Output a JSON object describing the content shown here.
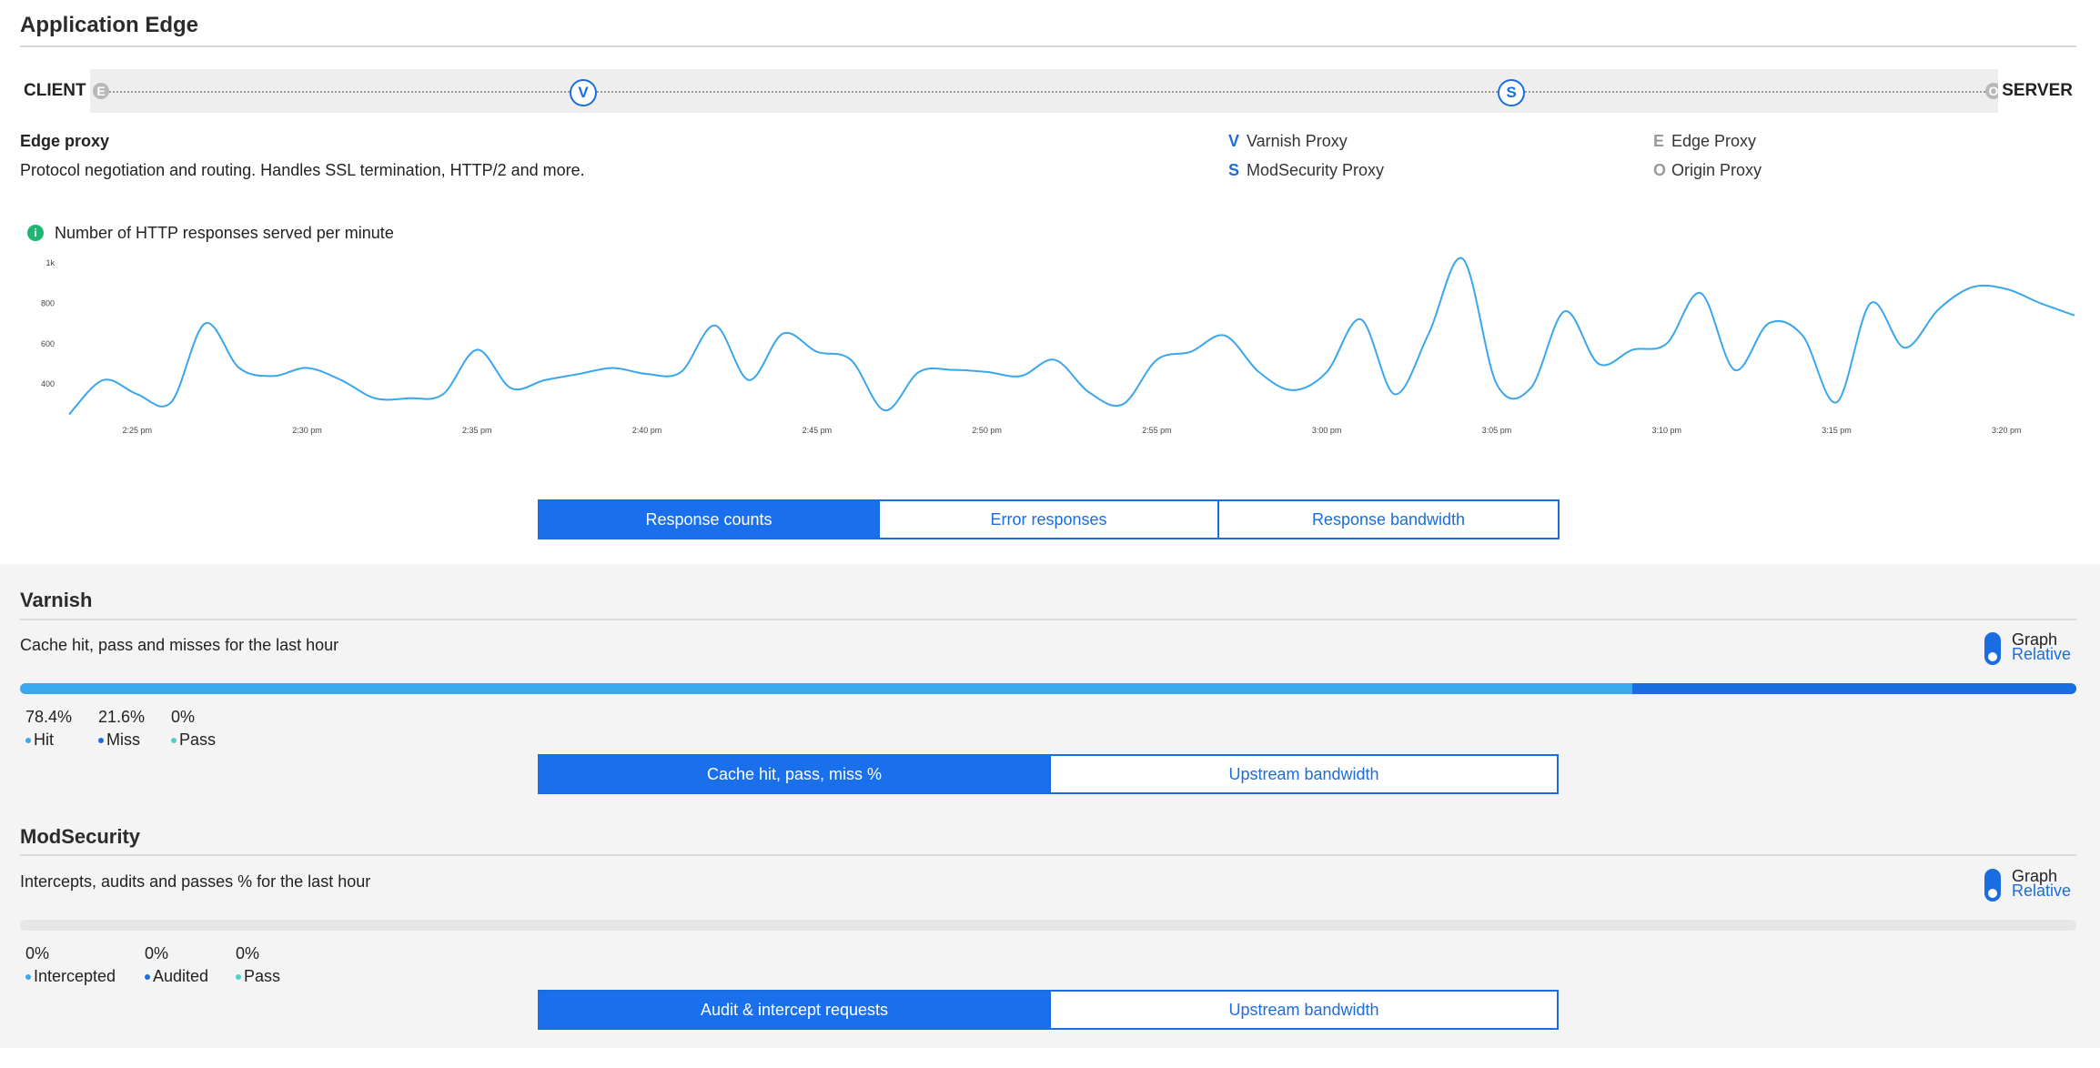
{
  "page": {
    "title": "Application Edge"
  },
  "pipeline": {
    "client_label": "CLIENT",
    "server_label": "SERVER",
    "nodes": [
      {
        "letter": "E",
        "state": "inactive"
      },
      {
        "letter": "V",
        "state": "active"
      },
      {
        "letter": "S",
        "state": "active"
      },
      {
        "letter": "O",
        "state": "inactive"
      }
    ]
  },
  "selected_component": {
    "title": "Edge proxy",
    "description": "Protocol negotiation and routing. Handles SSL termination, HTTP/2 and more."
  },
  "legend": [
    {
      "key": "V",
      "label": "Varnish Proxy",
      "color": "#1a6de0"
    },
    {
      "key": "S",
      "label": "ModSecurity Proxy",
      "color": "#1a6de0"
    },
    {
      "key": "E",
      "label": "Edge Proxy",
      "color": "#9a9a9a"
    },
    {
      "key": "O",
      "label": "Origin Proxy",
      "color": "#9a9a9a"
    }
  ],
  "chart_title": "Number of HTTP responses served per minute",
  "chart_data": {
    "type": "line",
    "ytick_labels": [
      "1k",
      "800",
      "600",
      "400"
    ],
    "yticks": [
      1000,
      800,
      600,
      400
    ],
    "ylim": [
      230,
      1040
    ],
    "xtick_labels": [
      "2:25 pm",
      "2:30 pm",
      "2:35 pm",
      "2:40 pm",
      "2:45 pm",
      "2:50 pm",
      "2:55 pm",
      "3:00 pm",
      "3:05 pm",
      "3:10 pm",
      "3:15 pm",
      "3:20 pm"
    ],
    "x_unit": "minutes after 2:23 pm",
    "xlim": [
      0,
      59
    ],
    "xticks": [
      2,
      7,
      12,
      17,
      22,
      27,
      32,
      37,
      42,
      47,
      52,
      57
    ],
    "line_color": "#3aa6ec",
    "series": [
      {
        "values": [
          [
            0,
            250
          ],
          [
            1,
            420
          ],
          [
            2,
            350
          ],
          [
            3,
            310
          ],
          [
            4,
            700
          ],
          [
            5,
            480
          ],
          [
            6,
            440
          ],
          [
            7,
            480
          ],
          [
            8,
            420
          ],
          [
            9,
            330
          ],
          [
            10,
            330
          ],
          [
            11,
            350
          ],
          [
            12,
            570
          ],
          [
            13,
            380
          ],
          [
            14,
            420
          ],
          [
            15,
            450
          ],
          [
            16,
            480
          ],
          [
            17,
            450
          ],
          [
            18,
            460
          ],
          [
            19,
            690
          ],
          [
            20,
            420
          ],
          [
            21,
            650
          ],
          [
            22,
            560
          ],
          [
            23,
            520
          ],
          [
            24,
            270
          ],
          [
            25,
            460
          ],
          [
            26,
            470
          ],
          [
            27,
            460
          ],
          [
            28,
            440
          ],
          [
            29,
            520
          ],
          [
            30,
            360
          ],
          [
            31,
            300
          ],
          [
            32,
            520
          ],
          [
            33,
            560
          ],
          [
            34,
            640
          ],
          [
            35,
            460
          ],
          [
            36,
            370
          ],
          [
            37,
            460
          ],
          [
            38,
            720
          ],
          [
            39,
            350
          ],
          [
            40,
            650
          ],
          [
            41,
            1020
          ],
          [
            42,
            400
          ],
          [
            43,
            380
          ],
          [
            44,
            760
          ],
          [
            45,
            500
          ],
          [
            46,
            570
          ],
          [
            47,
            600
          ],
          [
            48,
            850
          ],
          [
            49,
            470
          ],
          [
            50,
            700
          ],
          [
            51,
            640
          ],
          [
            52,
            310
          ],
          [
            53,
            800
          ],
          [
            54,
            580
          ],
          [
            55,
            770
          ],
          [
            56,
            880
          ],
          [
            57,
            870
          ],
          [
            58,
            800
          ],
          [
            59,
            740
          ]
        ]
      }
    ]
  },
  "response_tabs": {
    "active": 0,
    "items": [
      "Response counts",
      "Error responses",
      "Response bandwidth"
    ]
  },
  "varnish": {
    "title": "Varnish",
    "description": "Cache hit, pass and misses for the last hour",
    "toggle": {
      "label": "Graph",
      "sublabel": "Relative"
    },
    "bar": [
      {
        "value": 78.4,
        "color": "#3aa8ef"
      },
      {
        "value": 21.6,
        "color": "#1a6de0"
      },
      {
        "value": 0,
        "color": "#4fd1c5"
      }
    ],
    "stats": [
      {
        "value": "78.4%",
        "name": "Hit",
        "color": "#3aa8ef"
      },
      {
        "value": "21.6%",
        "name": "Miss",
        "color": "#1a6de0"
      },
      {
        "value": "0%",
        "name": "Pass",
        "color": "#4fd1c5"
      }
    ],
    "tabs": {
      "active": 0,
      "items": [
        "Cache hit, pass, miss %",
        "Upstream bandwidth"
      ]
    }
  },
  "modsecurity": {
    "title": "ModSecurity",
    "description": "Intercepts, audits and passes % for the last hour",
    "toggle": {
      "label": "Graph",
      "sublabel": "Relative"
    },
    "bar": [
      {
        "value": 0,
        "color": "#3aa8ef"
      },
      {
        "value": 0,
        "color": "#1a6de0"
      },
      {
        "value": 0,
        "color": "#4fd1c5"
      }
    ],
    "stats": [
      {
        "value": "0%",
        "name": "Intercepted",
        "color": "#3aa8ef"
      },
      {
        "value": "0%",
        "name": "Audited",
        "color": "#1a6de0"
      },
      {
        "value": "0%",
        "name": "Pass",
        "color": "#4fd1c5"
      }
    ],
    "tabs": {
      "active": 0,
      "items": [
        "Audit & intercept requests",
        "Upstream bandwidth"
      ]
    }
  }
}
